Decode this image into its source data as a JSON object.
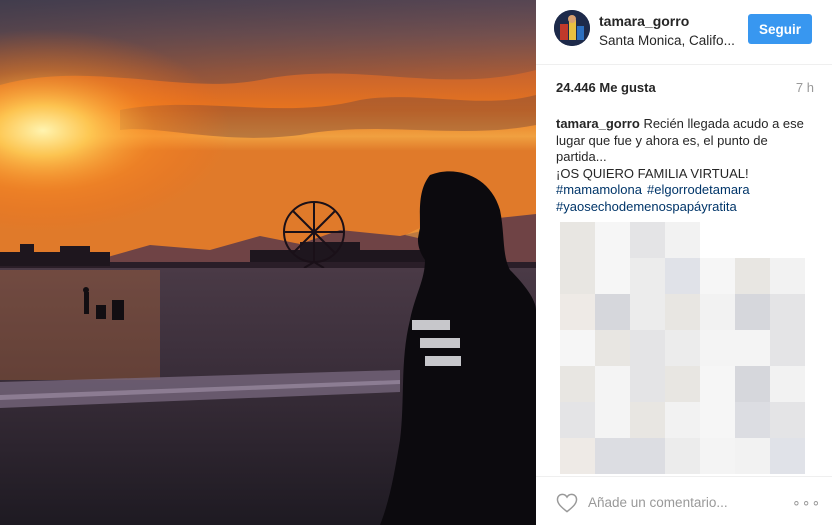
{
  "header": {
    "username": "tamara_gorro",
    "location": "Santa Monica, Califo...",
    "follow_label": "Seguir"
  },
  "stats": {
    "likes": "24.446 Me gusta",
    "time": "7 h"
  },
  "caption": {
    "username": "tamara_gorro",
    "text": "Recién llegada acudo a ese lugar que fue y ahora es, el punto de partida...",
    "line2": "¡OS QUIERO FAMILIA VIRTUAL!",
    "hashtags": [
      "#mamamolona",
      "#elgorrodetamara",
      "#yaosechodemenospapáyratita"
    ]
  },
  "footer": {
    "comment_placeholder": "Añade un comentario...",
    "more_label": "∘∘∘"
  },
  "icons": {
    "heart": "heart-icon",
    "more": "more-options-icon"
  },
  "colors": {
    "follow_button": "#3897f0",
    "hashtag": "#003569",
    "muted": "#999999"
  }
}
